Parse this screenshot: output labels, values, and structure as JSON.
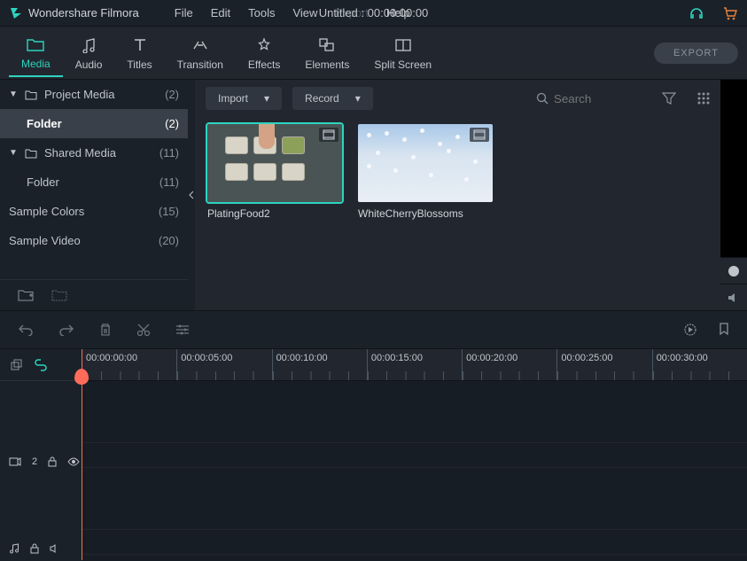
{
  "app": {
    "name": "Wondershare Filmora",
    "title": "Untitled : 00:00:00:00"
  },
  "menu": {
    "file": "File",
    "edit": "Edit",
    "tools": "Tools",
    "view": "View",
    "export": "Export",
    "help": "Help"
  },
  "toolbar": {
    "media": "Media",
    "audio": "Audio",
    "titles": "Titles",
    "transition": "Transition",
    "effects": "Effects",
    "elements": "Elements",
    "splitscreen": "Split Screen",
    "export_btn": "EXPORT"
  },
  "sidebar": {
    "project_media": "Project Media",
    "project_count": "(2)",
    "folder1": "Folder",
    "folder1_count": "(2)",
    "shared_media": "Shared Media",
    "shared_count": "(11)",
    "folder2": "Folder",
    "folder2_count": "(11)",
    "sample_colors": "Sample Colors",
    "sample_colors_count": "(15)",
    "sample_video": "Sample Video",
    "sample_video_count": "(20)"
  },
  "content": {
    "import": "Import",
    "record": "Record",
    "search_placeholder": "Search",
    "thumb1": "PlatingFood2",
    "thumb2": "WhiteCherryBlossoms"
  },
  "timeline": {
    "ticks": [
      "00:00:00:00",
      "00:00:05:00",
      "00:00:10:00",
      "00:00:15:00",
      "00:00:20:00",
      "00:00:25:00",
      "00:00:30:00"
    ],
    "track1_label": "2"
  }
}
